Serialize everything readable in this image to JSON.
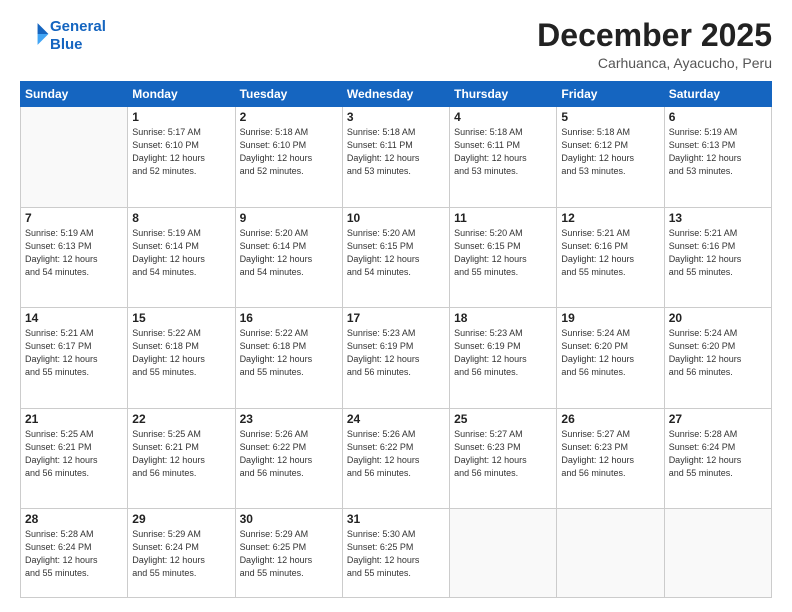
{
  "header": {
    "logo_line1": "General",
    "logo_line2": "Blue",
    "month_year": "December 2025",
    "location": "Carhuanca, Ayacucho, Peru"
  },
  "weekdays": [
    "Sunday",
    "Monday",
    "Tuesday",
    "Wednesday",
    "Thursday",
    "Friday",
    "Saturday"
  ],
  "weeks": [
    [
      {
        "day": "",
        "info": ""
      },
      {
        "day": "1",
        "info": "Sunrise: 5:17 AM\nSunset: 6:10 PM\nDaylight: 12 hours\nand 52 minutes."
      },
      {
        "day": "2",
        "info": "Sunrise: 5:18 AM\nSunset: 6:10 PM\nDaylight: 12 hours\nand 52 minutes."
      },
      {
        "day": "3",
        "info": "Sunrise: 5:18 AM\nSunset: 6:11 PM\nDaylight: 12 hours\nand 53 minutes."
      },
      {
        "day": "4",
        "info": "Sunrise: 5:18 AM\nSunset: 6:11 PM\nDaylight: 12 hours\nand 53 minutes."
      },
      {
        "day": "5",
        "info": "Sunrise: 5:18 AM\nSunset: 6:12 PM\nDaylight: 12 hours\nand 53 minutes."
      },
      {
        "day": "6",
        "info": "Sunrise: 5:19 AM\nSunset: 6:13 PM\nDaylight: 12 hours\nand 53 minutes."
      }
    ],
    [
      {
        "day": "7",
        "info": "Sunrise: 5:19 AM\nSunset: 6:13 PM\nDaylight: 12 hours\nand 54 minutes."
      },
      {
        "day": "8",
        "info": "Sunrise: 5:19 AM\nSunset: 6:14 PM\nDaylight: 12 hours\nand 54 minutes."
      },
      {
        "day": "9",
        "info": "Sunrise: 5:20 AM\nSunset: 6:14 PM\nDaylight: 12 hours\nand 54 minutes."
      },
      {
        "day": "10",
        "info": "Sunrise: 5:20 AM\nSunset: 6:15 PM\nDaylight: 12 hours\nand 54 minutes."
      },
      {
        "day": "11",
        "info": "Sunrise: 5:20 AM\nSunset: 6:15 PM\nDaylight: 12 hours\nand 55 minutes."
      },
      {
        "day": "12",
        "info": "Sunrise: 5:21 AM\nSunset: 6:16 PM\nDaylight: 12 hours\nand 55 minutes."
      },
      {
        "day": "13",
        "info": "Sunrise: 5:21 AM\nSunset: 6:16 PM\nDaylight: 12 hours\nand 55 minutes."
      }
    ],
    [
      {
        "day": "14",
        "info": "Sunrise: 5:21 AM\nSunset: 6:17 PM\nDaylight: 12 hours\nand 55 minutes."
      },
      {
        "day": "15",
        "info": "Sunrise: 5:22 AM\nSunset: 6:18 PM\nDaylight: 12 hours\nand 55 minutes."
      },
      {
        "day": "16",
        "info": "Sunrise: 5:22 AM\nSunset: 6:18 PM\nDaylight: 12 hours\nand 55 minutes."
      },
      {
        "day": "17",
        "info": "Sunrise: 5:23 AM\nSunset: 6:19 PM\nDaylight: 12 hours\nand 56 minutes."
      },
      {
        "day": "18",
        "info": "Sunrise: 5:23 AM\nSunset: 6:19 PM\nDaylight: 12 hours\nand 56 minutes."
      },
      {
        "day": "19",
        "info": "Sunrise: 5:24 AM\nSunset: 6:20 PM\nDaylight: 12 hours\nand 56 minutes."
      },
      {
        "day": "20",
        "info": "Sunrise: 5:24 AM\nSunset: 6:20 PM\nDaylight: 12 hours\nand 56 minutes."
      }
    ],
    [
      {
        "day": "21",
        "info": "Sunrise: 5:25 AM\nSunset: 6:21 PM\nDaylight: 12 hours\nand 56 minutes."
      },
      {
        "day": "22",
        "info": "Sunrise: 5:25 AM\nSunset: 6:21 PM\nDaylight: 12 hours\nand 56 minutes."
      },
      {
        "day": "23",
        "info": "Sunrise: 5:26 AM\nSunset: 6:22 PM\nDaylight: 12 hours\nand 56 minutes."
      },
      {
        "day": "24",
        "info": "Sunrise: 5:26 AM\nSunset: 6:22 PM\nDaylight: 12 hours\nand 56 minutes."
      },
      {
        "day": "25",
        "info": "Sunrise: 5:27 AM\nSunset: 6:23 PM\nDaylight: 12 hours\nand 56 minutes."
      },
      {
        "day": "26",
        "info": "Sunrise: 5:27 AM\nSunset: 6:23 PM\nDaylight: 12 hours\nand 56 minutes."
      },
      {
        "day": "27",
        "info": "Sunrise: 5:28 AM\nSunset: 6:24 PM\nDaylight: 12 hours\nand 55 minutes."
      }
    ],
    [
      {
        "day": "28",
        "info": "Sunrise: 5:28 AM\nSunset: 6:24 PM\nDaylight: 12 hours\nand 55 minutes."
      },
      {
        "day": "29",
        "info": "Sunrise: 5:29 AM\nSunset: 6:24 PM\nDaylight: 12 hours\nand 55 minutes."
      },
      {
        "day": "30",
        "info": "Sunrise: 5:29 AM\nSunset: 6:25 PM\nDaylight: 12 hours\nand 55 minutes."
      },
      {
        "day": "31",
        "info": "Sunrise: 5:30 AM\nSunset: 6:25 PM\nDaylight: 12 hours\nand 55 minutes."
      },
      {
        "day": "",
        "info": ""
      },
      {
        "day": "",
        "info": ""
      },
      {
        "day": "",
        "info": ""
      }
    ]
  ]
}
